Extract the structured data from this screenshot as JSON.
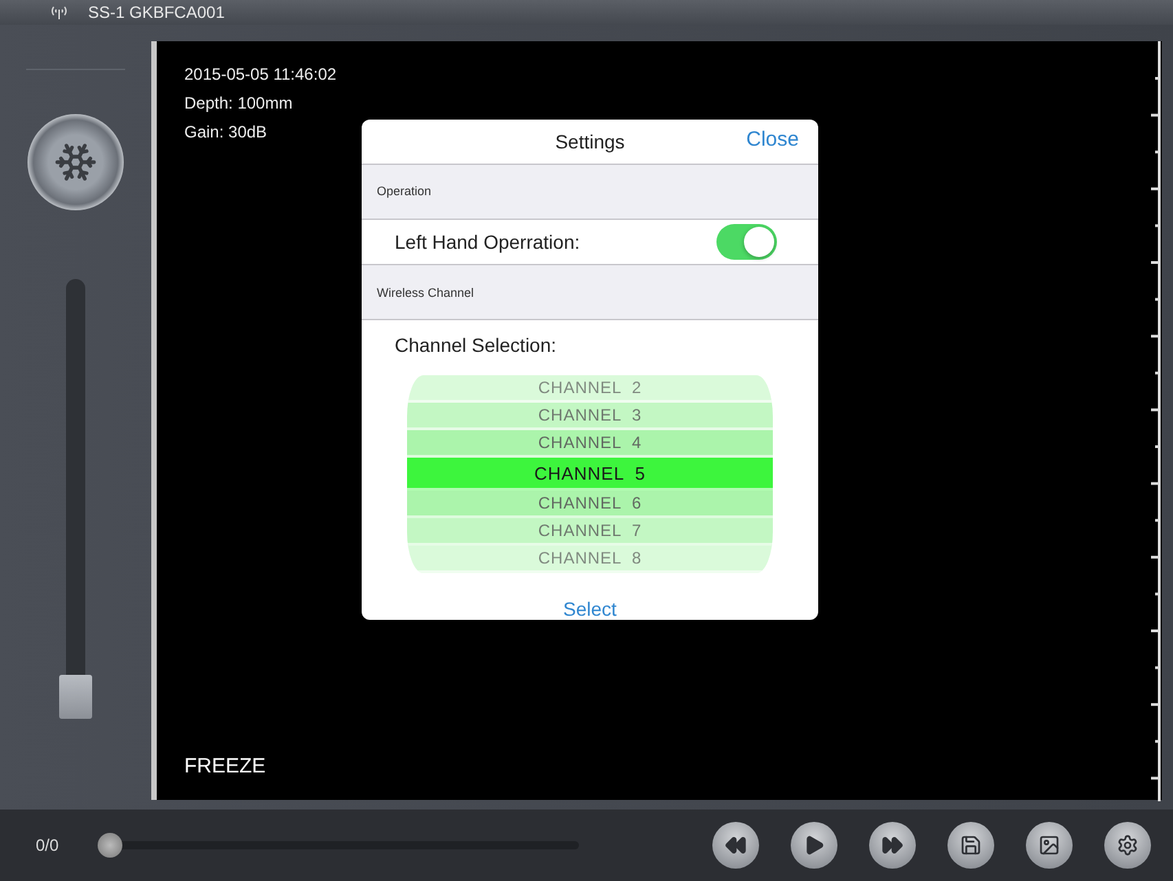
{
  "status_bar": {
    "device": "SS-1 GKBFCA001"
  },
  "side_panel": {
    "gain_slider": {
      "level": 0
    }
  },
  "image_view": {
    "info": [
      "2015-05-05 11:46:02",
      "Depth: 100mm",
      "Gain: 30dB"
    ],
    "mode": "FREEZE"
  },
  "settings_dialog": {
    "title": "Settings",
    "close": "Close",
    "sections": [
      {
        "header": "Operation",
        "rows": [
          {
            "kind": "toggle",
            "label": "Left Hand Operration:",
            "on": true
          }
        ]
      },
      {
        "header": "Wireless Channel",
        "rows": [
          {
            "kind": "picker",
            "label": "Channel Selection:",
            "options": [
              {
                "label": "CHANNEL  2",
                "selected": false
              },
              {
                "label": "CHANNEL  3",
                "selected": false
              },
              {
                "label": "CHANNEL  4",
                "selected": false
              },
              {
                "label": "CHANNEL  5",
                "selected": true
              },
              {
                "label": "CHANNEL  6",
                "selected": false
              },
              {
                "label": "CHANNEL  7",
                "selected": false
              },
              {
                "label": "CHANNEL  8",
                "selected": false
              }
            ]
          }
        ]
      }
    ],
    "action": "Select"
  },
  "playback_bar": {
    "counter": "0/0",
    "progress": {
      "level": 0
    },
    "buttons": [
      {
        "kind": "rewind"
      },
      {
        "kind": "play"
      },
      {
        "kind": "forward"
      },
      {
        "kind": "save"
      },
      {
        "kind": "capture"
      },
      {
        "kind": "settings"
      }
    ]
  }
}
